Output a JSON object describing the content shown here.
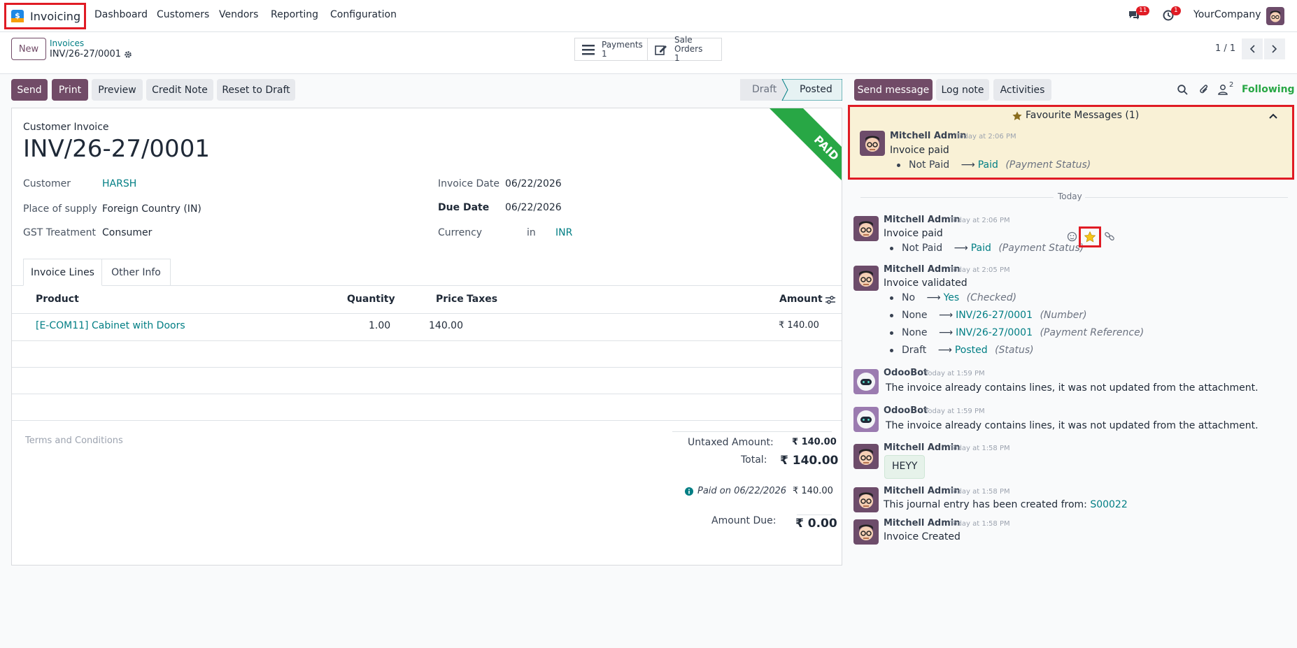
{
  "navbar": {
    "app_name": "Invoicing",
    "menus": [
      "Dashboard",
      "Customers",
      "Vendors",
      "Reporting",
      "Configuration"
    ],
    "messages_count": "11",
    "activities_count": "1",
    "company": "YourCompany"
  },
  "control": {
    "new_label": "New",
    "breadcrumb_parent": "Invoices",
    "record_name": "INV/26-27/0001",
    "payments_label": "Payments",
    "payments_count": "1",
    "sale_orders_label": "Sale Orders",
    "sale_orders_count": "1",
    "pager": "1 / 1"
  },
  "actions": {
    "send": "Send",
    "print": "Print",
    "preview": "Preview",
    "credit_note": "Credit Note",
    "reset_to_draft": "Reset to Draft",
    "status_draft": "Draft",
    "status_posted": "Posted"
  },
  "invoice": {
    "type_label": "Customer Invoice",
    "number": "INV/26-27/0001",
    "ribbon": "PAID",
    "customer_label": "Customer",
    "customer": "HARSH",
    "supply_label": "Place of supply",
    "supply": "Foreign Country (IN)",
    "gst_label": "GST Treatment",
    "gst": "Consumer",
    "invoice_date_label": "Invoice Date",
    "invoice_date": "06/22/2026",
    "due_date_label": "Due Date",
    "due_date": "06/22/2026",
    "currency_label": "Currency",
    "currency_in": "in",
    "currency": "INR",
    "tabs": [
      "Invoice Lines",
      "Other Info"
    ],
    "columns": {
      "product": "Product",
      "quantity": "Quantity",
      "price": "Price",
      "taxes": "Taxes",
      "amount": "Amount"
    },
    "lines": [
      {
        "product": "[E-COM11] Cabinet with Doors",
        "quantity": "1.00",
        "price": "140.00",
        "taxes": "",
        "amount": "₹ 140.00"
      }
    ],
    "terms_placeholder": "Terms and Conditions",
    "untaxed_label": "Untaxed Amount:",
    "untaxed": "₹ 140.00",
    "total_label": "Total:",
    "total": "₹ 140.00",
    "paid_on": "Paid on 06/22/2026",
    "paid_amount": "₹ 140.00",
    "amount_due_label": "Amount Due:",
    "amount_due": "₹ 0.00"
  },
  "chatter": {
    "send_message": "Send message",
    "log_note": "Log note",
    "activities": "Activities",
    "followers_count": "2",
    "following": "Following",
    "favourites_title": "Favourite Messages (1)",
    "fav_message": {
      "author": "Mitchell Admin",
      "time": "Today at 2:06 PM",
      "body": "Invoice paid",
      "change": {
        "from": "Not Paid",
        "to": "Paid",
        "field": "(Payment Status)"
      }
    },
    "date_separator": "Today",
    "messages": [
      {
        "author": "Mitchell Admin",
        "time": "Today at 2:06 PM",
        "body": "Invoice paid",
        "changes": [
          {
            "from": "Not Paid",
            "to": "Paid",
            "field": "(Payment Status)"
          }
        ]
      },
      {
        "author": "Mitchell Admin",
        "time": "Today at 2:05 PM",
        "body": "Invoice validated",
        "changes": [
          {
            "from": "No",
            "to": "Yes",
            "field": "(Checked)"
          },
          {
            "from": "None",
            "to": "INV/26-27/0001",
            "field": "(Number)"
          },
          {
            "from": "None",
            "to": "INV/26-27/0001",
            "field": "(Payment Reference)"
          },
          {
            "from": "Draft",
            "to": "Posted",
            "field": "(Status)"
          }
        ]
      },
      {
        "author": "OdooBot",
        "time": "Today at 1:59 PM",
        "body": "The invoice already contains lines, it was not updated from the attachment."
      },
      {
        "author": "OdooBot",
        "time": "Today at 1:59 PM",
        "body": "The invoice already contains lines, it was not updated from the attachment."
      },
      {
        "author": "Mitchell Admin",
        "time": "Today at 1:58 PM",
        "body": "HEYY"
      },
      {
        "author": "Mitchell Admin",
        "time": "Today at 1:58 PM",
        "body": "This journal entry has been created from:",
        "link": "S00022"
      },
      {
        "author": "Mitchell Admin",
        "time": "Today at 1:58 PM",
        "body": "Invoice Created"
      }
    ]
  },
  "colors": {
    "primary": "#714b67",
    "link": "#017e84",
    "paid_ribbon": "#28a745",
    "highlight": "#e01b24",
    "favourite_bg": "#f9f1d6"
  }
}
